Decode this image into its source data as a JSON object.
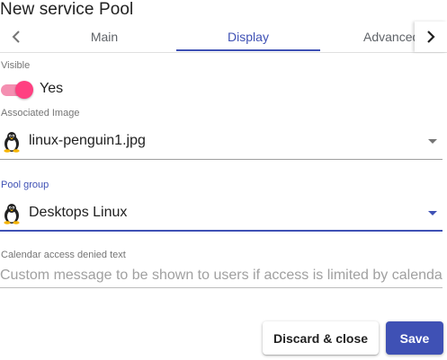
{
  "dialog": {
    "title": "New service Pool"
  },
  "tabs": [
    {
      "label": "Main"
    },
    {
      "label": "Display",
      "active": true
    },
    {
      "label": "Advanced"
    }
  ],
  "fields": {
    "visible": {
      "label": "Visible",
      "value": "Yes",
      "checked": true
    },
    "image": {
      "label": "Associated Image",
      "value": "linux-penguin1.jpg",
      "icon": "penguin-icon"
    },
    "pool_group": {
      "label": "Pool group",
      "value": "Desktops Linux",
      "icon": "penguin-icon"
    },
    "calendar_message": {
      "label": "Calendar access denied text",
      "value": "",
      "placeholder": "Custom message to be shown to users if access is limited by calendar rules."
    }
  },
  "actions": {
    "discard_label": "Discard & close",
    "save_label": "Save"
  },
  "colors": {
    "accent": "#3f51b5",
    "toggle_on": "#ff4081"
  }
}
